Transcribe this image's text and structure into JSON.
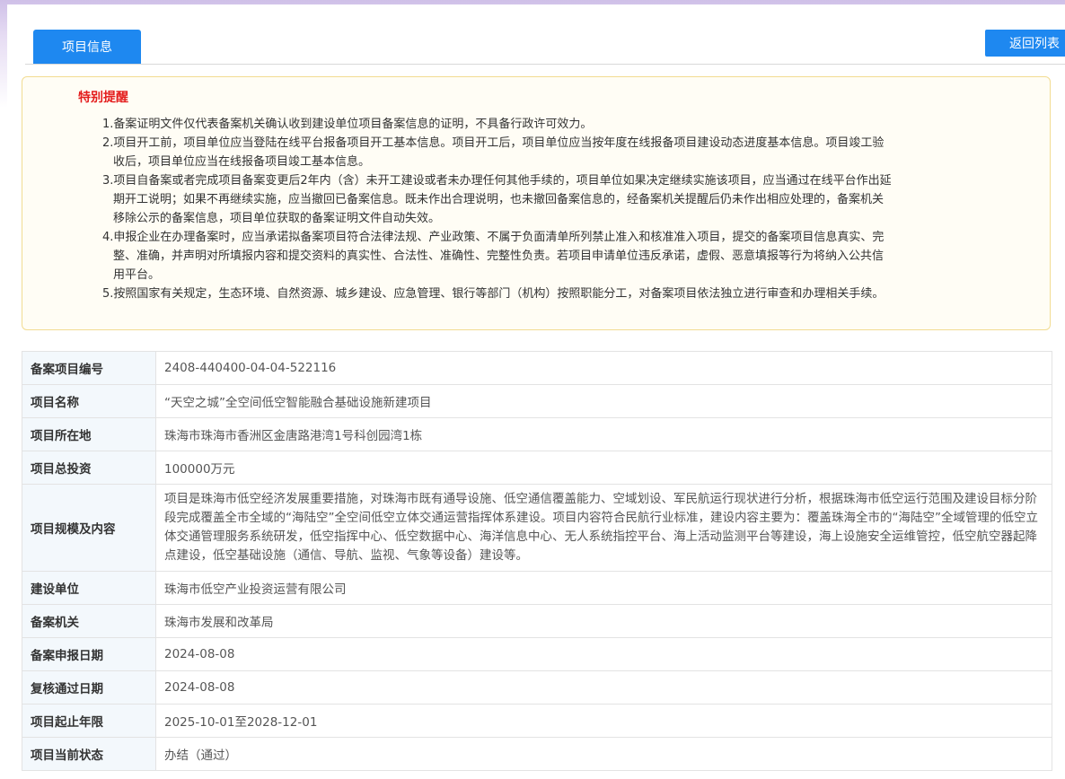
{
  "tabs": {
    "active_label": "项目信息"
  },
  "actions": {
    "back_label": "返回列表"
  },
  "notice": {
    "title": "特别提醒",
    "items": [
      "1.备案证明文件仅代表备案机关确认收到建设单位项目备案信息的证明，不具备行政许可效力。",
      "2.项目开工前，项目单位应当登陆在线平台报备项目开工基本信息。项目开工后，项目单位应当按年度在线报备项目建设动态进度基本信息。项目竣工验收后，项目单位应当在线报备项目竣工基本信息。",
      "3.项目自备案或者完成项目备案变更后2年内（含）未开工建设或者未办理任何其他手续的，项目单位如果决定继续实施该项目，应当通过在线平台作出延期开工说明；如果不再继续实施，应当撤回已备案信息。既未作出合理说明，也未撤回备案信息的，经备案机关提醒后仍未作出相应处理的，备案机关移除公示的备案信息，项目单位获取的备案证明文件自动失效。",
      "4.申报企业在办理备案时，应当承诺拟备案项目符合法律法规、产业政策、不属于负面清单所列禁止准入和核准准入项目，提交的备案项目信息真实、完整、准确，并声明对所填报内容和提交资料的真实性、合法性、准确性、完整性负责。若项目申请单位违反承诺，虚假、恶意填报等行为将纳入公共信用平台。",
      "5.按照国家有关规定，生态环境、自然资源、城乡建设、应急管理、银行等部门（机构）按照职能分工，对备案项目依法独立进行审查和办理相关手续。"
    ]
  },
  "project": {
    "rows": [
      {
        "label": "备案项目编号",
        "value": "2408-440400-04-04-522116"
      },
      {
        "label": "项目名称",
        "value": "“天空之城”全空间低空智能融合基础设施新建项目"
      },
      {
        "label": "项目所在地",
        "value": "珠海市珠海市香洲区金唐路港湾1号科创园湾1栋"
      },
      {
        "label": "项目总投资",
        "value": "100000万元"
      },
      {
        "label": "项目规模及内容",
        "value": "项目是珠海市低空经济发展重要措施，对珠海市既有通导设施、低空通信覆盖能力、空域划设、军民航运行现状进行分析，根据珠海市低空运行范围及建设目标分阶段完成覆盖全市全域的“海陆空”全空间低空立体交通运营指挥体系建设。项目内容符合民航行业标准，建设内容主要为：覆盖珠海全市的“海陆空”全域管理的低空立体交通管理服务系统研发，低空指挥中心、低空数据中心、海洋信息中心、无人系统指控平台、海上活动监测平台等建设，海上设施安全运维管控，低空航空器起降点建设，低空基础设施（通信、导航、监视、气象等设备）建设等。"
      },
      {
        "label": "建设单位",
        "value": "珠海市低空产业投资运营有限公司"
      },
      {
        "label": "备案机关",
        "value": "珠海市发展和改革局"
      },
      {
        "label": "备案申报日期",
        "value": "2024-08-08"
      },
      {
        "label": "复核通过日期",
        "value": "2024-08-08"
      },
      {
        "label": "项目起止年限",
        "value": "2025-10-01至2028-12-01"
      },
      {
        "label": "项目当前状态",
        "value": "办结（通过）"
      }
    ]
  }
}
